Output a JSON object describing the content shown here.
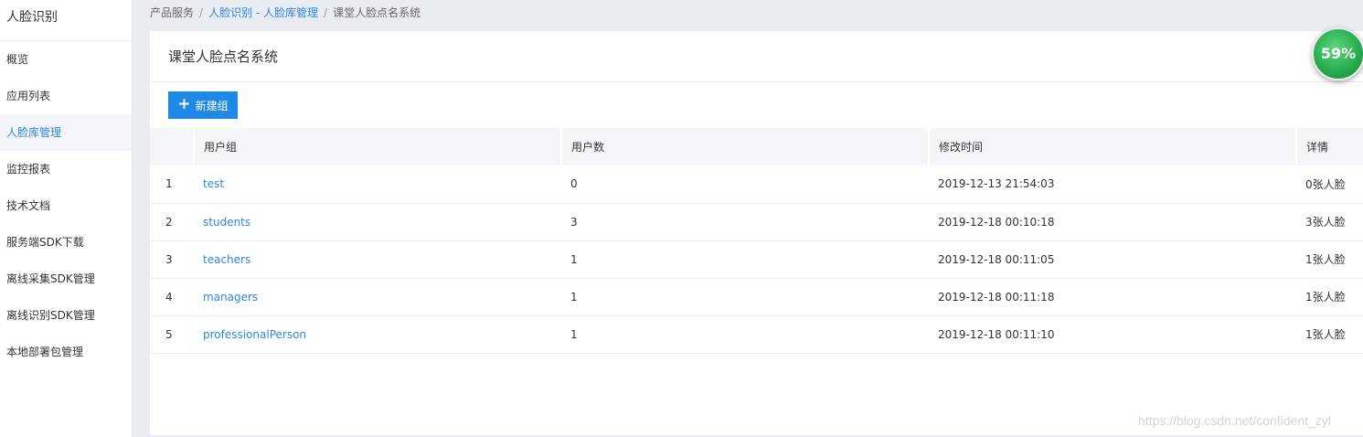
{
  "sidebar": {
    "title": "人脸识别",
    "items": [
      {
        "label": "概览"
      },
      {
        "label": "应用列表"
      },
      {
        "label": "人脸库管理"
      },
      {
        "label": "监控报表"
      },
      {
        "label": "技术文档"
      },
      {
        "label": "服务端SDK下载"
      },
      {
        "label": "离线采集SDK管理"
      },
      {
        "label": "离线识别SDK管理"
      },
      {
        "label": "本地部署包管理"
      }
    ],
    "active_item": "人脸库管理"
  },
  "breadcrumb": {
    "root": "产品服务",
    "link": "人脸识别 - 人脸库管理",
    "current": "课堂人脸点名系统",
    "separator": "/"
  },
  "panel": {
    "title": "课堂人脸点名系统",
    "new_group_button": "新建组",
    "new_group_icon": "plus-icon"
  },
  "table": {
    "headers": [
      "",
      "用户组",
      "用户数",
      "修改时间",
      "详情"
    ],
    "rows": [
      {
        "index": "1",
        "group": "test",
        "count": "0",
        "modified": "2019-12-13 21:54:03",
        "detail": "0张人脸"
      },
      {
        "index": "2",
        "group": "students",
        "count": "3",
        "modified": "2019-12-18 00:10:18",
        "detail": "3张人脸"
      },
      {
        "index": "3",
        "group": "teachers",
        "count": "1",
        "modified": "2019-12-18 00:11:05",
        "detail": "1张人脸"
      },
      {
        "index": "4",
        "group": "managers",
        "count": "1",
        "modified": "2019-12-18 00:11:18",
        "detail": "1张人脸"
      },
      {
        "index": "5",
        "group": "professionalPerson",
        "count": "1",
        "modified": "2019-12-18 00:11:10",
        "detail": "1张人脸"
      }
    ]
  },
  "overlay": {
    "progress_label": "59%",
    "progress_value": 59,
    "progress_color": "#27ae4f"
  },
  "watermark": "https://blog.csdn.net/confident_zyl",
  "colors": {
    "accent": "#1e8ae6",
    "link": "#2d87e2"
  }
}
